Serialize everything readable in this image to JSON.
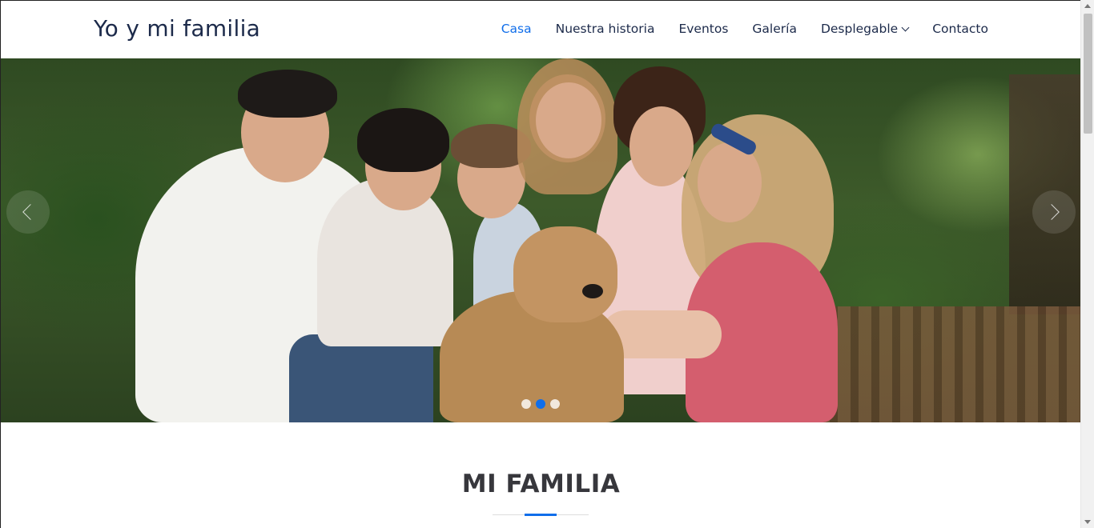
{
  "brand": {
    "name": "Yo y mi familia"
  },
  "nav": {
    "items": [
      {
        "label": "Casa",
        "active": true
      },
      {
        "label": "Nuestra historia",
        "active": false
      },
      {
        "label": "Eventos",
        "active": false
      },
      {
        "label": "Galería",
        "active": false
      },
      {
        "label": "Desplegable",
        "active": false,
        "has_dropdown": true
      },
      {
        "label": "Contacto",
        "active": false
      }
    ]
  },
  "carousel": {
    "prev_icon": "chevron-left-icon",
    "next_icon": "chevron-right-icon",
    "slide_count": 3,
    "active_slide": 2
  },
  "section": {
    "title": "MI FAMILIA"
  },
  "colors": {
    "accent": "#106eea",
    "text_dark": "#1c2a4a",
    "heading": "#37373c"
  }
}
